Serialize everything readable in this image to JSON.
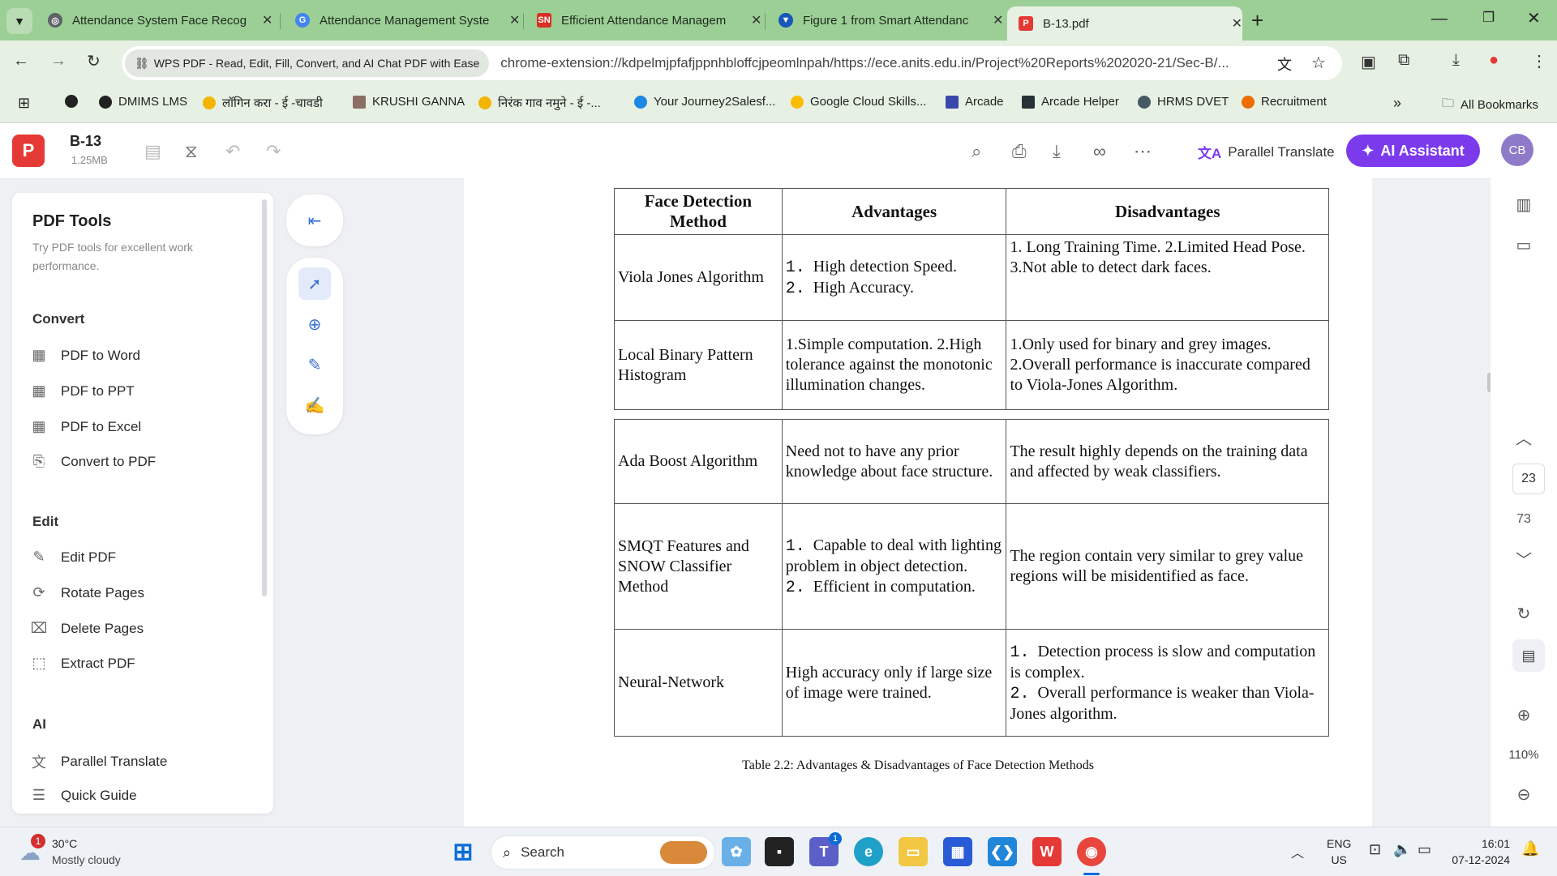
{
  "browser": {
    "tabs": [
      {
        "title": "Attendance System Face Recog",
        "favicon": "globe-icon",
        "color": "#5f6368"
      },
      {
        "title": "Attendance Management Syste",
        "favicon": "google-icon",
        "color": "#4285f4"
      },
      {
        "title": "Efficient Attendance Managem",
        "favicon": "sn-icon",
        "color": "#d93025"
      },
      {
        "title": "Figure 1 from Smart Attendanc",
        "favicon": "semantic-scholar-icon",
        "color": "#1857b6"
      },
      {
        "title": "B-13.pdf",
        "favicon": "wps-pdf-icon",
        "color": "#e53935"
      }
    ],
    "omnibox": {
      "chip": "WPS PDF - Read, Edit, Fill, Convert, and AI Chat PDF with Ease",
      "url": "chrome-extension://kdpelmjpfafjppnhbloffcjpeomlnpah/https://ece.anits.edu.in/Project%20Reports%202020-21/Sec-B/..."
    },
    "bookmarks": [
      {
        "label": "",
        "color": "#222222"
      },
      {
        "label": "DMIMS LMS",
        "color": "#222222"
      },
      {
        "label": "लॉगिन करा - ई -चावडी",
        "color": "#f4b400"
      },
      {
        "label": "KRUSHI GANNA",
        "color": "#8d6e63"
      },
      {
        "label": "निरंक गाव नमुने - ई -...",
        "color": "#f4b400"
      },
      {
        "label": "Your Journey2Salesf...",
        "color": "#1e88e5"
      },
      {
        "label": "Google Cloud Skills...",
        "color": "#fbbc04"
      },
      {
        "label": "Arcade",
        "color": "#3949ab"
      },
      {
        "label": "Arcade Helper",
        "color": "#263238"
      },
      {
        "label": "HRMS DVET",
        "color": "#455a64"
      },
      {
        "label": "Recruitment",
        "color": "#ef6c00"
      }
    ],
    "all_bookmarks": "All Bookmarks"
  },
  "app": {
    "doc_name": "B-13",
    "doc_size": "1.25MB",
    "parallel_translate": "Parallel Translate",
    "ai_assistant": "AI Assistant",
    "avatar": "CB"
  },
  "left_panel": {
    "title": "PDF Tools",
    "subtitle": "Try PDF tools for excellent work performance.",
    "sections": {
      "convert": "Convert",
      "edit": "Edit",
      "ai": "AI"
    },
    "convert_items": [
      "PDF to Word",
      "PDF to PPT",
      "PDF to Excel",
      "Convert to PDF"
    ],
    "edit_items": [
      "Edit PDF",
      "Rotate Pages",
      "Delete Pages",
      "Extract PDF"
    ],
    "ai_items": [
      "Parallel Translate",
      "Quick Guide"
    ]
  },
  "document": {
    "table_headers": [
      "Face Detection Method",
      "Advantages",
      "Disadvantages"
    ],
    "rows": [
      {
        "method": "Viola Jones Algorithm",
        "adv": [
          {
            "n": "1.",
            "t": "High detection Speed."
          },
          {
            "n": "2.",
            "t": "High Accuracy."
          }
        ],
        "dis": "1. Long Training Time. 2.Limited Head Pose. 3.Not able to detect dark faces."
      },
      {
        "method": "Local Binary Pattern Histogram",
        "adv_text": "1.Simple computation. 2.High tolerance against the monotonic illumination changes.",
        "dis": "1.Only used for binary and grey images. 2.Overall performance is inaccurate compared to Viola-Jones Algorithm."
      },
      {
        "method": "Ada Boost Algorithm",
        "adv_text": "Need not to have any prior knowledge about face structure.",
        "dis": "The result highly depends on the training data and affected by weak classifiers."
      },
      {
        "method": "SMQT Features and SNOW Classifier Method",
        "adv": [
          {
            "n": "1.",
            "t": "Capable to deal with lighting problem in object detection."
          },
          {
            "n": "2.",
            "t": "Efficient in computation."
          }
        ],
        "dis": "The region contain very similar to grey value regions will be misidentified as face."
      },
      {
        "method": "Neural-Network",
        "adv_text": "High accuracy only if large size of image were trained.",
        "dis_list": [
          {
            "n": "1.",
            "t": "Detection process is slow and computation is complex."
          },
          {
            "n": "2.",
            "t": "Overall performance is weaker than Viola-Jones algorithm."
          }
        ]
      }
    ],
    "caption": "Table 2.2: Advantages & Disadvantages of Face Detection Methods"
  },
  "right_rail": {
    "current_page": "23",
    "total_pages": "73",
    "zoom": "110%"
  },
  "taskbar": {
    "weather_temp": "30°C",
    "weather_desc": "Mostly cloudy",
    "weather_badge": "1",
    "search_placeholder": "Search",
    "teams_badge": "1",
    "lang": "ENG",
    "region": "US",
    "time": "16:01",
    "date": "07-12-2024"
  }
}
